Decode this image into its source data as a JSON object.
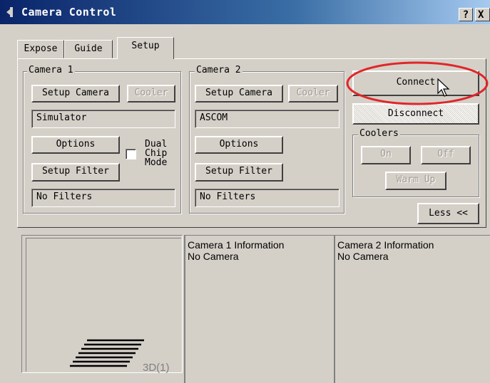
{
  "window": {
    "title": "Camera Control",
    "help_label": "?",
    "close_label": "X"
  },
  "tabs": [
    {
      "label": "Expose",
      "active": false
    },
    {
      "label": "Guide",
      "active": false
    },
    {
      "label": "Setup",
      "active": true
    }
  ],
  "camera1": {
    "group_label": "Camera 1",
    "setup_camera": "Setup Camera",
    "cooler": "Cooler",
    "driver": "Simulator",
    "options": "Options",
    "dual_chip_line1": "Dual",
    "dual_chip_line2": "Chip",
    "dual_chip_line3": "Mode",
    "dual_chip_checked": false,
    "setup_filter": "Setup Filter",
    "filters": "No Filters"
  },
  "camera2": {
    "group_label": "Camera 2",
    "setup_camera": "Setup Camera",
    "cooler": "Cooler",
    "driver": "ASCOM",
    "options": "Options",
    "setup_filter": "Setup Filter",
    "filters": "No Filters"
  },
  "connection": {
    "connect": "Connect",
    "disconnect": "Disconnect"
  },
  "coolers": {
    "group_label": "Coolers",
    "on": "On",
    "off": "Off",
    "warm_up": "Warm Up"
  },
  "less_button": "Less <<",
  "info": {
    "camera1_title": "Camera 1 Information",
    "camera1_status": "No Camera",
    "camera2_title": "Camera 2 Information",
    "camera2_status": "No Camera"
  },
  "preview_label": "3D(1)",
  "colors": {
    "highlight_ellipse": "#e0262a",
    "titlebar": "#0a246a",
    "face": "#d4d0c8"
  }
}
